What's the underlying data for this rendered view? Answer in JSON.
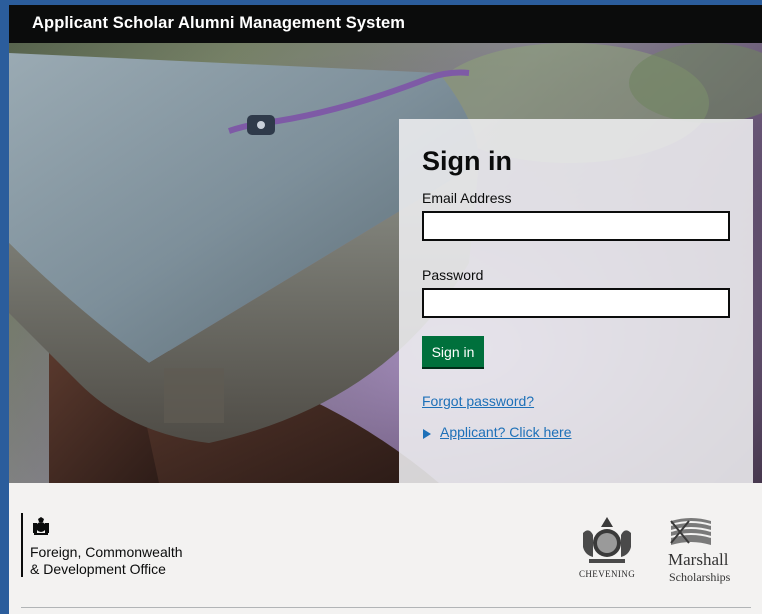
{
  "header": {
    "title": "Applicant Scholar Alumni Management System"
  },
  "signin": {
    "title": "Sign in",
    "email_label": "Email Address",
    "email_value": "",
    "password_label": "Password",
    "password_value": "",
    "button_label": "Sign in",
    "forgot_link": "Forgot password?",
    "applicant_link": "Applicant? Click here"
  },
  "footer": {
    "fcdo_line1": "Foreign, Commonwealth",
    "fcdo_line2": "& Development Office",
    "chevening_label": "CHEVENING",
    "marshall_title": "Marshall",
    "marshall_sub": "Scholarships"
  },
  "colors": {
    "header_bg": "#0b0c0c",
    "button_green": "#00703c",
    "link_blue": "#1d70b8",
    "frame_blue": "#2b5d9c"
  },
  "icons": [
    "royal-crest-icon",
    "chevening-crest-icon",
    "marshall-flag-icon",
    "triangle-right-icon"
  ]
}
